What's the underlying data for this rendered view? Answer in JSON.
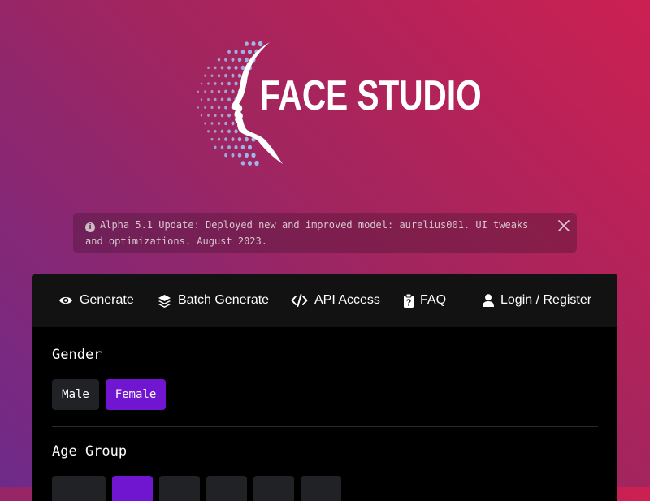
{
  "brand": {
    "name": "FACE STUDIO"
  },
  "alert": {
    "text": "Alpha 5.1 Update: Deployed new and improved model: aurelius001. UI tweaks and optimizations. August 2023.",
    "info_icon": "info-circle-icon",
    "close_icon": "close-icon"
  },
  "nav": {
    "items": [
      {
        "label": "Generate",
        "icon": "eye-icon"
      },
      {
        "label": "Batch Generate",
        "icon": "layers-icon"
      },
      {
        "label": "API Access",
        "icon": "code-icon"
      },
      {
        "label": "FAQ",
        "icon": "clipboard-question-icon"
      },
      {
        "label": "Login / Register",
        "icon": "user-icon"
      }
    ]
  },
  "gender": {
    "label": "Gender",
    "options": [
      "Male",
      "Female"
    ],
    "selected": "Female"
  },
  "age_group": {
    "label": "Age Group"
  },
  "colors": {
    "accent": "#7016d0",
    "background_start": "#cc2052",
    "background_end": "#6e2a8a",
    "card": "#000000",
    "nav": "#121212"
  }
}
